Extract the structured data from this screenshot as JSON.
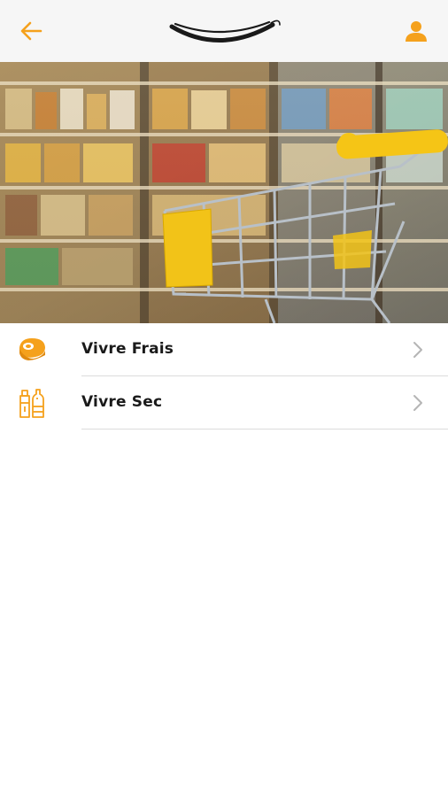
{
  "header": {
    "back_icon": "arrow-left-icon",
    "logo_icon": "smile-logo-icon",
    "profile_icon": "user-icon",
    "accent_color": "#f5a11c"
  },
  "hero": {
    "image": "supermarket-shopping-cart-photo"
  },
  "menu": {
    "items": [
      {
        "label": "Vivre Frais",
        "icon": "meat-steak-icon"
      },
      {
        "label": "Vivre Sec",
        "icon": "groceries-bottles-icon"
      }
    ]
  }
}
